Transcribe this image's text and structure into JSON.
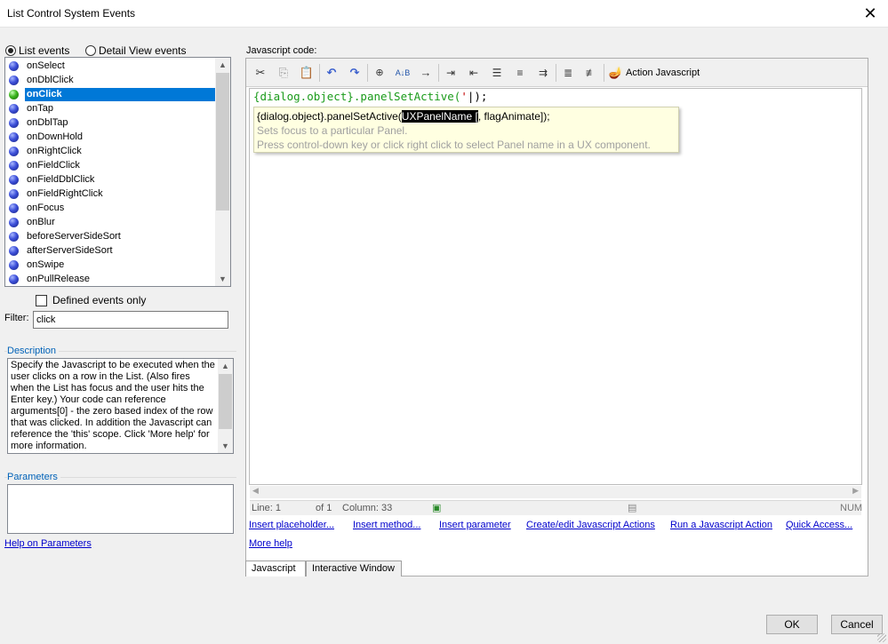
{
  "window": {
    "title": "List Control System Events",
    "close_glyph": "✕"
  },
  "event_type": {
    "list_label": "List events",
    "detail_label": "Detail View events",
    "selected": "List events"
  },
  "events": [
    {
      "label": "onSelect",
      "icon": "blue-ball-icon",
      "selected": false
    },
    {
      "label": "onDblClick",
      "icon": "blue-ball-icon",
      "selected": false
    },
    {
      "label": "onClick",
      "icon": "green-ball-icon",
      "selected": true
    },
    {
      "label": "onTap",
      "icon": "blue-ball-icon",
      "selected": false
    },
    {
      "label": "onDblTap",
      "icon": "blue-ball-icon",
      "selected": false
    },
    {
      "label": "onDownHold",
      "icon": "blue-ball-icon",
      "selected": false
    },
    {
      "label": "onRightClick",
      "icon": "blue-ball-icon",
      "selected": false
    },
    {
      "label": "onFieldClick",
      "icon": "blue-ball-icon",
      "selected": false
    },
    {
      "label": "onFieldDblClick",
      "icon": "blue-ball-icon",
      "selected": false
    },
    {
      "label": "onFieldRightClick",
      "icon": "blue-ball-icon",
      "selected": false
    },
    {
      "label": "onFocus",
      "icon": "blue-ball-icon",
      "selected": false
    },
    {
      "label": "onBlur",
      "icon": "blue-ball-icon",
      "selected": false
    },
    {
      "label": "beforeServerSideSort",
      "icon": "blue-ball-icon",
      "selected": false
    },
    {
      "label": "afterServerSideSort",
      "icon": "blue-ball-icon",
      "selected": false
    },
    {
      "label": "onSwipe",
      "icon": "blue-ball-icon",
      "selected": false
    },
    {
      "label": "onPullRelease",
      "icon": "blue-ball-icon",
      "selected": false
    }
  ],
  "defined_only": {
    "label": "Defined events only",
    "checked": false
  },
  "filter": {
    "label": "Filter:",
    "value": "click"
  },
  "description": {
    "heading": "Description",
    "text": "Specify the Javascript to be executed when the user clicks on a row in the List. (Also fires when the List has focus and the user hits the Enter key.)  Your code can reference arguments[0]  - the zero based index of the row that was clicked. In addition the Javascript can reference the 'this' scope. Click 'More help' for more information."
  },
  "parameters": {
    "heading": "Parameters",
    "value": ""
  },
  "help_link": "Help on Parameters",
  "js_panel": {
    "heading": "Javascript code:",
    "toolbar": {
      "cut": "cut-icon",
      "copy": "copy-icon",
      "paste": "paste-icon",
      "undo": "undo-icon",
      "redo": "redo-icon",
      "find": "binoculars-icon",
      "replace": "replace-icon",
      "goto": "arrow-right-icon",
      "action_label": "Action Javascript"
    },
    "code_obj": "{dialog.object}",
    "code_method": ".panelSetActive(",
    "code_str": "'",
    "code_tail": "|);",
    "tooltip": {
      "prefix": "{dialog.object}.panelSetActive(",
      "highlight": "UXPanelName [",
      "suffix": ", flagAnimate]);",
      "line2": "Sets focus to a particular Panel.",
      "line3": "Press control-down key or click right click to select Panel name in a UX component."
    },
    "status": {
      "line": "Line: 1",
      "of": "of 1",
      "column": "Column: 33",
      "num": "NUM"
    }
  },
  "links": {
    "insert_placeholder": "Insert placeholder...",
    "insert_method": "Insert method...",
    "insert_parameter": "Insert parameter",
    "create_edit": "Create/edit Javascript Actions",
    "run_action": "Run a Javascript Action",
    "quick_access": "Quick Access...",
    "more_help": "More help"
  },
  "tabs": [
    "Javascript",
    "Interactive Window"
  ],
  "buttons": {
    "ok": "OK",
    "cancel": "Cancel"
  }
}
